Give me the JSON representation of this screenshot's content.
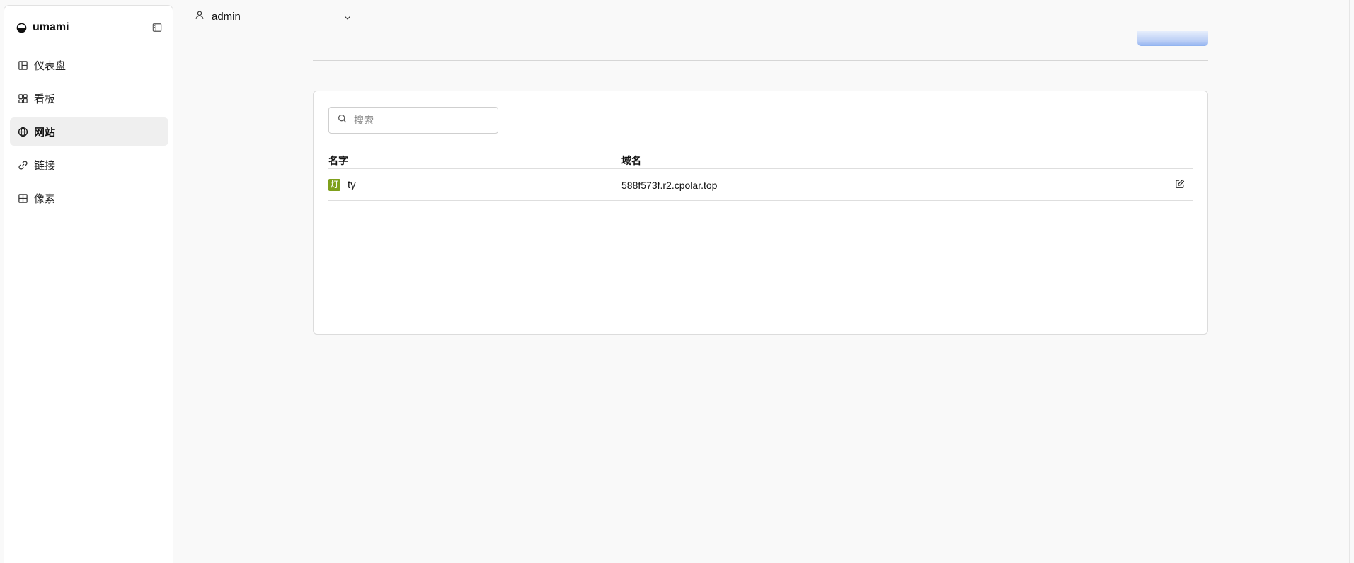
{
  "brand": {
    "name": "umami"
  },
  "sidebar": {
    "items": [
      {
        "label": "仪表盘",
        "icon": "dashboard-icon",
        "active": false
      },
      {
        "label": "看板",
        "icon": "boards-icon",
        "active": false
      },
      {
        "label": "网站",
        "icon": "globe-icon",
        "active": true
      },
      {
        "label": "链接",
        "icon": "link-icon",
        "active": false
      },
      {
        "label": "像素",
        "icon": "grid-icon",
        "active": false
      }
    ]
  },
  "header": {
    "user": "admin"
  },
  "search": {
    "placeholder": "搜索",
    "value": ""
  },
  "table": {
    "columns": [
      "名字",
      "域名"
    ],
    "rows": [
      {
        "favicon_text": "灯",
        "name": "ty",
        "domain": "588f573f.r2.cpolar.top"
      }
    ]
  },
  "colors": {
    "accent": "#3b82f6",
    "active_bg": "#efefef",
    "favicon": "#7fa01c"
  }
}
